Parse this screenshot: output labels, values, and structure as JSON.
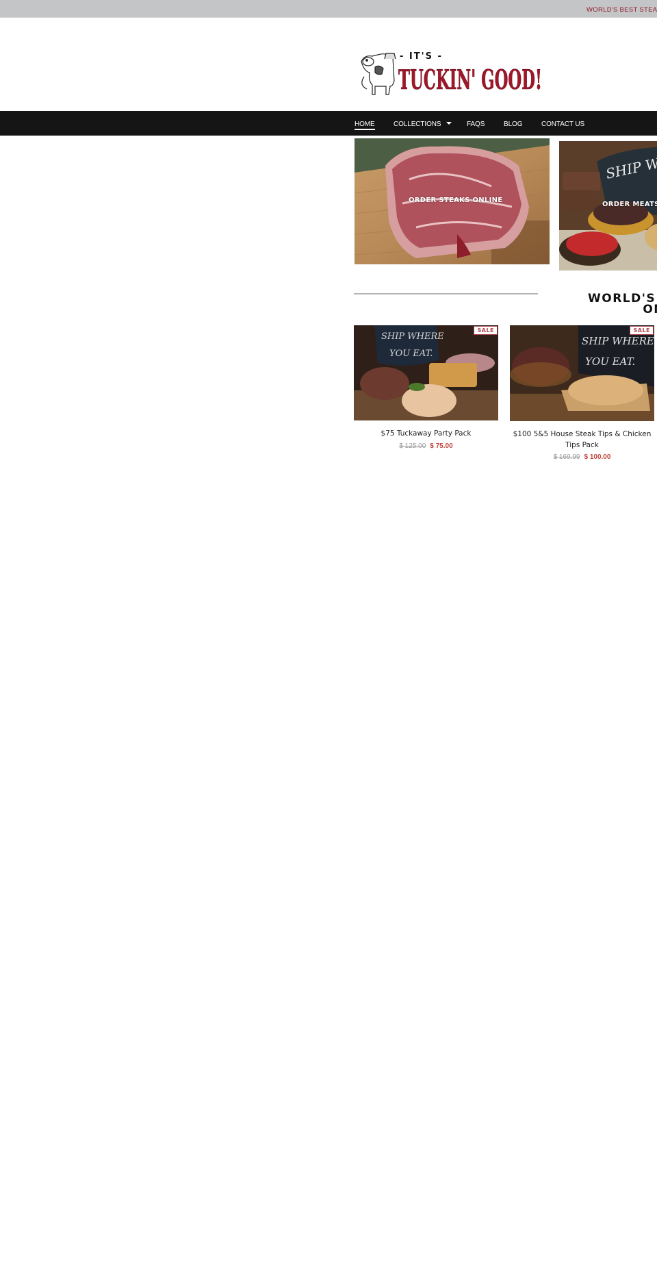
{
  "announcement": {
    "text": "WORLD'S BEST STEAK TIPS DELIVERED"
  },
  "logo": {
    "top_text": "- IT'S -",
    "main_text": "TUCKIN' GOOD!",
    "alt": "It's Tuckin' Good logo with cow illustration",
    "brand_color": "#a0172a"
  },
  "nav": {
    "items": [
      {
        "label": "HOME",
        "active": true
      },
      {
        "label": "COLLECTIONS",
        "has_dropdown": true
      },
      {
        "label": "FAQS"
      },
      {
        "label": "BLOG"
      },
      {
        "label": "CONTACT US"
      }
    ]
  },
  "collections": [
    {
      "label": "ORDER STEAKS ONLINE",
      "image": "raw-ribeye-steak-on-cutting-board"
    },
    {
      "label": "ORDER MEATS ONLINE",
      "image": "marinated-meats-ship-where-you-eat"
    }
  ],
  "featured": {
    "heading_line1": "WORLD'S BEST",
    "heading_line2": "ONLINE"
  },
  "products": [
    {
      "title": "$75 Tuckaway Party Pack",
      "badge": "SALE",
      "price_compare": "$ 125.00",
      "price_sale": "$ 75.00",
      "image": "party-pack-meats-and-sides"
    },
    {
      "title": "$100 5&5 House Steak Tips & Chicken Tips Pack",
      "badge": "SALE",
      "price_compare": "$ 169.99",
      "price_sale": "$ 100.00",
      "image": "steak-tips-and-chicken-tips"
    }
  ],
  "colors": {
    "announcement_bg": "#c4c5c6",
    "announcement_text": "#8e1d2c",
    "nav_bg": "#151515",
    "sale": "#b1454e",
    "price_sale": "#c0473d"
  }
}
